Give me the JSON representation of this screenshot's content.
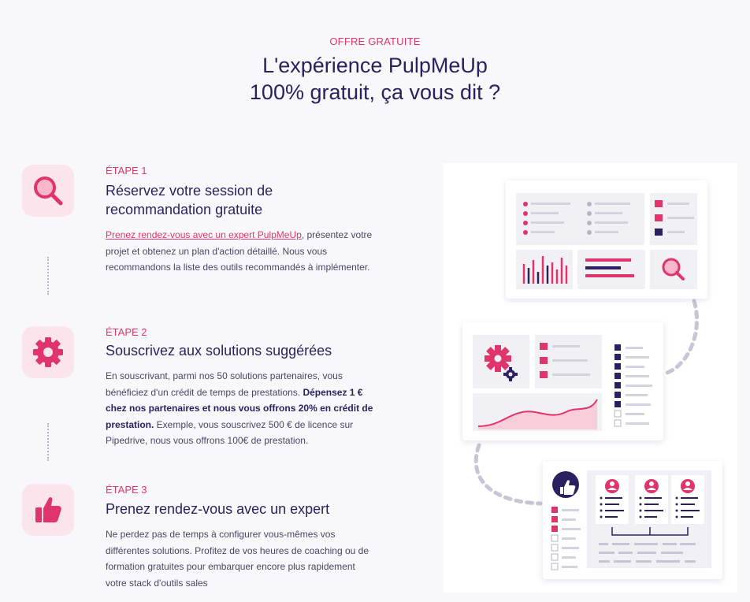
{
  "header": {
    "eyebrow": "OFFRE GRATUITE",
    "title_line1": "L'expérience PulpMeUp",
    "title_line2": "100% gratuit, ça vous dit ?"
  },
  "steps": [
    {
      "label": "ÉTAPE 1",
      "heading": "Réservez votre session de recommandation gratuite",
      "link": "Prenez rendez-vous avec un expert PulpMeUp",
      "text_after_link": ", présentez votre projet et obtenez un plan d'action détaillé. Nous vous recommandons la liste des outils recommandés à implémenter.",
      "icon": "search-icon"
    },
    {
      "label": "ÉTAPE 2",
      "heading": "Souscrivez aux solutions suggérées",
      "text_part1": "En souscrivant, parmi nos 50 solutions partenaires, vous bénéficiez d'un crédit de temps de prestations. ",
      "text_bold": "Dépensez 1 € chez nos partenaires et nous vous offrons 20% en crédit de prestation.",
      "text_part2": " Exemple, vous souscrivez 500 € de licence sur Pipedrive, nous vous offrons 100€ de prestation.",
      "icon": "gear-icon"
    },
    {
      "label": "ÉTAPE 3",
      "heading": "Prenez rendez-vous avec un expert",
      "text": "Ne perdez pas de temps à configurer vous-mêmes vos différentes solutions. Profitez de vos heures de coaching ou de formation gratuites pour embarquer encore plus rapidement votre stack d'outils sales",
      "icon": "thumbs-up-icon"
    }
  ],
  "colors": {
    "accent": "#e0356b",
    "navy": "#2a2260",
    "icon_bg": "#fce4ec"
  }
}
